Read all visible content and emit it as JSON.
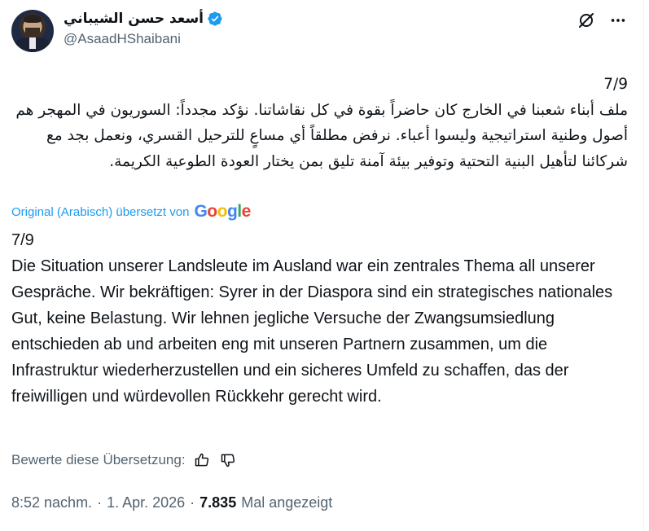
{
  "author": {
    "display_name": "أسعد حسن الشيباني",
    "handle": "@AsaadHShaibani",
    "verified_badge_icon": "verified-badge-icon",
    "verified_color": "#1d9bf0"
  },
  "header": {
    "grok_icon": "grok-icon",
    "more_icon": "more-options-icon"
  },
  "post": {
    "original_text": "7/9\nملف أبناء شعبنا في الخارج كان حاضراً بقوة في كل نقاشاتنا. نؤكد مجدداً: السوريون في المهجر هم أصول وطنية استراتيجية وليسوا أعباء. نرفض مطلقاً أي مساعٍ للترحيل القسري، ونعمل بجد مع شركائنا لتأهيل البنية التحتية وتوفير بيئة آمنة تليق بمن يختار العودة الطوعية الكريمة.",
    "translated_by_label": "Original (Arabisch) übersetzt von",
    "translation_provider": "Google",
    "translated_text": "7/9\nDie Situation unserer Landsleute im Ausland war ein zentrales Thema all unserer Gespräche. Wir bekräftigen: Syrer in der Diaspora sind ein strategisches nationales Gut, keine Belastung. Wir lehnen jegliche Versuche der Zwangsumsiedlung entschieden ab und arbeiten eng mit unseren Partnern zusammen, um die Infrastruktur wiederherzustellen und ein sicheres Umfeld zu schaffen, das der freiwilligen und würdevollen Rückkehr gerecht wird."
  },
  "rating": {
    "label": "Bewerte diese Übersetzung:",
    "thumbs_up_icon": "thumbs-up-icon",
    "thumbs_down_icon": "thumbs-down-icon"
  },
  "meta": {
    "time": "8:52 nachm.",
    "separator1": "·",
    "date": "1. Apr. 2026",
    "separator2": "·",
    "views_count": "7.835",
    "views_label": "Mal angezeigt"
  },
  "colors": {
    "text_primary": "#0f1419",
    "text_secondary": "#536471",
    "link_blue": "#1d9bf0",
    "google_blue": "#4285f4",
    "google_red": "#ea4335",
    "google_yellow": "#fbbc05",
    "google_green": "#34a853"
  }
}
